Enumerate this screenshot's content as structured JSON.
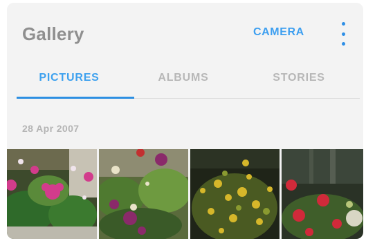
{
  "app": {
    "title": "Gallery"
  },
  "toolbar": {
    "camera_label": "CAMERA",
    "more_icon": "more-vertical-icon"
  },
  "tabs": [
    {
      "label": "PICTURES",
      "active": true
    },
    {
      "label": "ALBUMS",
      "active": false
    },
    {
      "label": "STORIES",
      "active": false
    }
  ],
  "section": {
    "date": "28 Apr 2007"
  },
  "photos": [
    {
      "subject": "pink-flowers"
    },
    {
      "subject": "purple-columbine-flowers"
    },
    {
      "subject": "yellow-flowering-shrub"
    },
    {
      "subject": "red-flowers"
    }
  ],
  "colors": {
    "accent": "#3da1ef",
    "title": "#8f8f8f",
    "inactive_tab": "#b7b7b7"
  }
}
